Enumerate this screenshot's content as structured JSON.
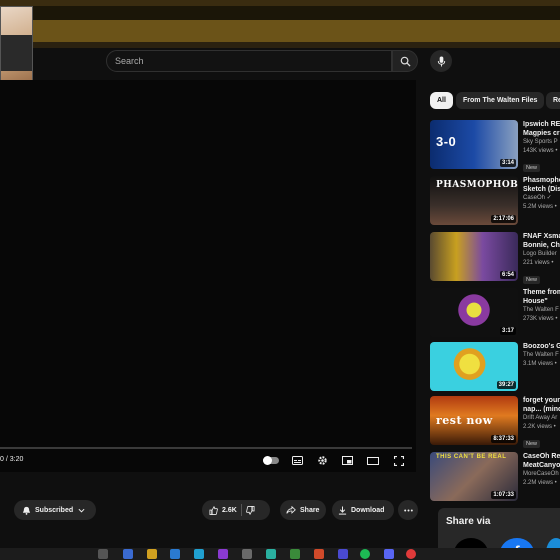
{
  "search": {
    "placeholder": "Search"
  },
  "player": {
    "time": "0 / 3:20"
  },
  "actions": {
    "subscribed": "Subscribed",
    "likes": "2.6K",
    "share": "Share",
    "download": "Download"
  },
  "chips": [
    "All",
    "From The Walten Files",
    "Re"
  ],
  "recommendations": [
    {
      "title": "Ipswich RE",
      "title2": "Magpies cr",
      "channel": "Sky Sports P",
      "views": "143K views •",
      "duration": "3:14",
      "badge": "New",
      "thumb_text": "3-0"
    },
    {
      "title": "Phasmopho",
      "title2": "Sketch (Dis",
      "channel": "CaseOh ✓",
      "views": "5.2M views •",
      "duration": "2:17:06",
      "badge": "",
      "thumb_text": "PHASMOPHOBIA"
    },
    {
      "title": "FNAF Xsma",
      "title2": "Bonnie, Chi",
      "channel": "Logo Builder",
      "views": "221 views •",
      "duration": "6:54",
      "badge": "New",
      "thumb_text": ""
    },
    {
      "title": "Theme from",
      "title2": "House\"",
      "channel": "The Walten F",
      "views": "273K views •",
      "duration": "3:17",
      "badge": "",
      "thumb_text": ""
    },
    {
      "title": "Boozoo's G",
      "title2": "",
      "channel": "The Walten F",
      "views": "3.1M views •",
      "duration": "39:27",
      "badge": "",
      "thumb_text": ""
    },
    {
      "title": "forget your",
      "title2": "nap... (minc",
      "channel": "Drift Away Ar",
      "views": "2.2K views •",
      "duration": "8:37:33",
      "badge": "New",
      "thumb_text": "rest now"
    },
    {
      "title": "CaseOh Re",
      "title2": "MeatCanyo",
      "channel": "MoreCaseOh",
      "views": "2.2M views •",
      "duration": "1:07:33",
      "badge": "",
      "thumb_text": "THIS CAN'T BE REAL"
    }
  ],
  "share_popup": {
    "title": "Share via",
    "x_label": "X",
    "fb_label": "f"
  },
  "colors": {
    "accent": "#f1f1f1",
    "background": "#0f0f0f",
    "chip": "#272727",
    "facebook": "#1877f2"
  }
}
